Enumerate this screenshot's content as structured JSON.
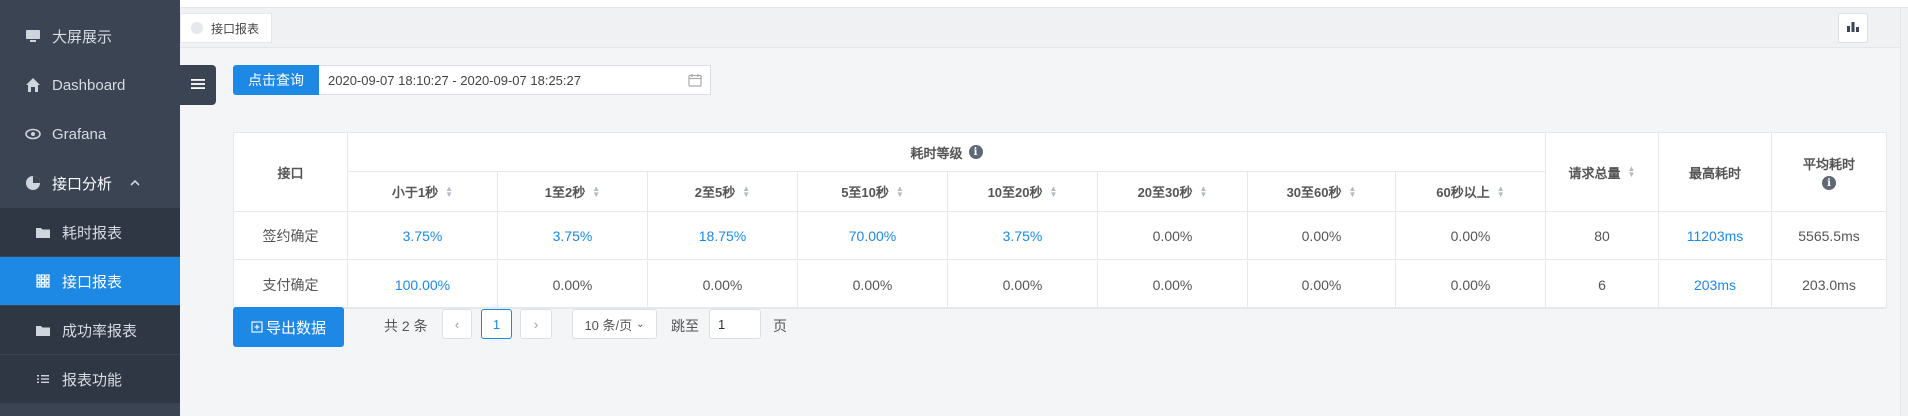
{
  "sidebar": {
    "items": [
      {
        "label": "大屏展示",
        "icon": "monitor-icon"
      },
      {
        "label": "Dashboard",
        "icon": "home-icon"
      },
      {
        "label": "Grafana",
        "icon": "eye-icon"
      },
      {
        "label": "接口分析",
        "icon": "pie-chart-icon",
        "expanded": true
      },
      {
        "label": "耗时报表",
        "icon": "folder-icon"
      },
      {
        "label": "接口报表",
        "icon": "grid-icon",
        "active": true
      },
      {
        "label": "成功率报表",
        "icon": "folder-icon"
      },
      {
        "label": "报表功能",
        "icon": "list-icon"
      }
    ]
  },
  "tabs": [
    {
      "label": "接口报表"
    }
  ],
  "query": {
    "button_label": "点击查询",
    "date_range": "2020-09-07 18:10:27 - 2020-09-07 18:25:27"
  },
  "table": {
    "header_interface": "接口",
    "header_group": "耗时等级",
    "header_total": "请求总量",
    "header_max": "最高耗时",
    "header_avg": "平均耗时",
    "levels": [
      "小于1秒",
      "1至2秒",
      "2至5秒",
      "5至10秒",
      "10至20秒",
      "20至30秒",
      "30至60秒",
      "60秒以上"
    ],
    "rows": [
      {
        "name": "签约确定",
        "levels": [
          "3.75%",
          "3.75%",
          "18.75%",
          "70.00%",
          "3.75%",
          "0.00%",
          "0.00%",
          "0.00%"
        ],
        "total": "80",
        "max": "11203ms",
        "avg": "5565.5ms"
      },
      {
        "name": "支付确定",
        "levels": [
          "100.00%",
          "0.00%",
          "0.00%",
          "0.00%",
          "0.00%",
          "0.00%",
          "0.00%",
          "0.00%"
        ],
        "total": "6",
        "max": "203ms",
        "avg": "203.0ms"
      }
    ]
  },
  "footer": {
    "export_label": "导出数据",
    "total_text": "共 2 条",
    "current_page": "1",
    "page_size": "10 条/页",
    "jump_label": "跳至",
    "jump_value": "1",
    "page_suffix": "页"
  },
  "colors": {
    "accent": "#1e88e5",
    "sidebar_bg": "#3a4452"
  }
}
